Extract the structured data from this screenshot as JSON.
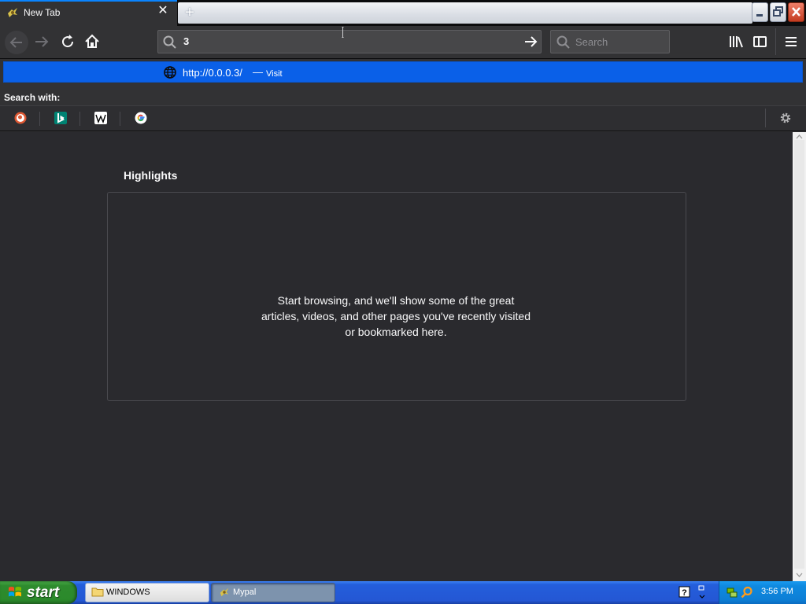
{
  "window": {
    "tab_title": "New Tab",
    "tab_close_glyph": "✕",
    "new_tab_glyph": "+"
  },
  "navbar": {
    "url_value": "3",
    "search_placeholder": "Search"
  },
  "autocomplete": {
    "url": "http://0.0.0.3/",
    "separator": "—",
    "action": "Visit",
    "search_with_label": "Search with:",
    "engines": [
      "duckduckgo-icon",
      "bing-icon",
      "wikipedia-icon",
      "google-icon"
    ]
  },
  "content": {
    "highlights_title": "Highlights",
    "empty_message": "Start browsing, and we'll show some of the great articles, videos, and other pages you've recently visited or bookmarked here."
  },
  "taskbar": {
    "start_label": "start",
    "tasks": [
      {
        "label": "WINDOWS",
        "active": false
      },
      {
        "label": "Mypal",
        "active": true
      }
    ],
    "clock": "3:56 PM"
  },
  "colors": {
    "accent": "#0a84ff",
    "selection": "#0a60e8",
    "background": "#2a2a2e",
    "toolbar": "#323234"
  }
}
